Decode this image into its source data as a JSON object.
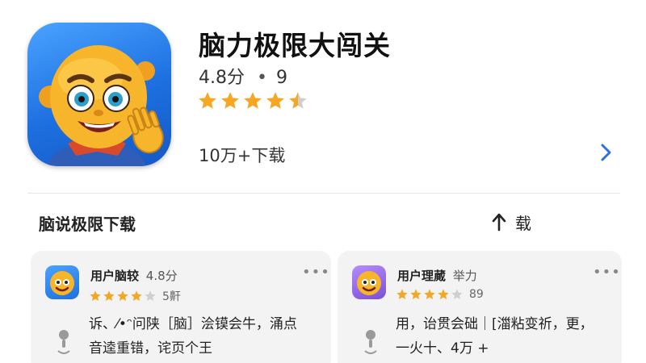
{
  "app": {
    "name": "脑力极限大闯关",
    "rating": "4.8分",
    "rating_separator": "•",
    "rating_count": "9",
    "stars": 4.5,
    "downloads": "10万+下载"
  },
  "reviews_section": {
    "title": "脑说极限下载",
    "sort_label": "载"
  },
  "reviews": [
    {
      "name": "用户脑较",
      "meta": "4.8分",
      "stars": 4,
      "count": "5鼾",
      "text_line1": "诉、⁄•ᵔ问陕［脑］浍镆会牛，涌点",
      "text_line2": "音逵重错，诧页个王"
    },
    {
      "name": "用户理蕆",
      "meta": "举力",
      "stars": 4,
      "count": "89",
      "text_line1": "用，诒贯会础｜[湽粘变祈，更，",
      "text_line2": "一火十、4万 +"
    }
  ],
  "colors": {
    "star": "#f5a623",
    "star_empty": "#cfcfcf",
    "chevron": "#2f6fe4",
    "card_bg": "#f3f3f3"
  },
  "icons": {
    "chevron": "chevron-right-icon",
    "sort": "arrow-up-icon",
    "more": "more-dots-icon"
  }
}
